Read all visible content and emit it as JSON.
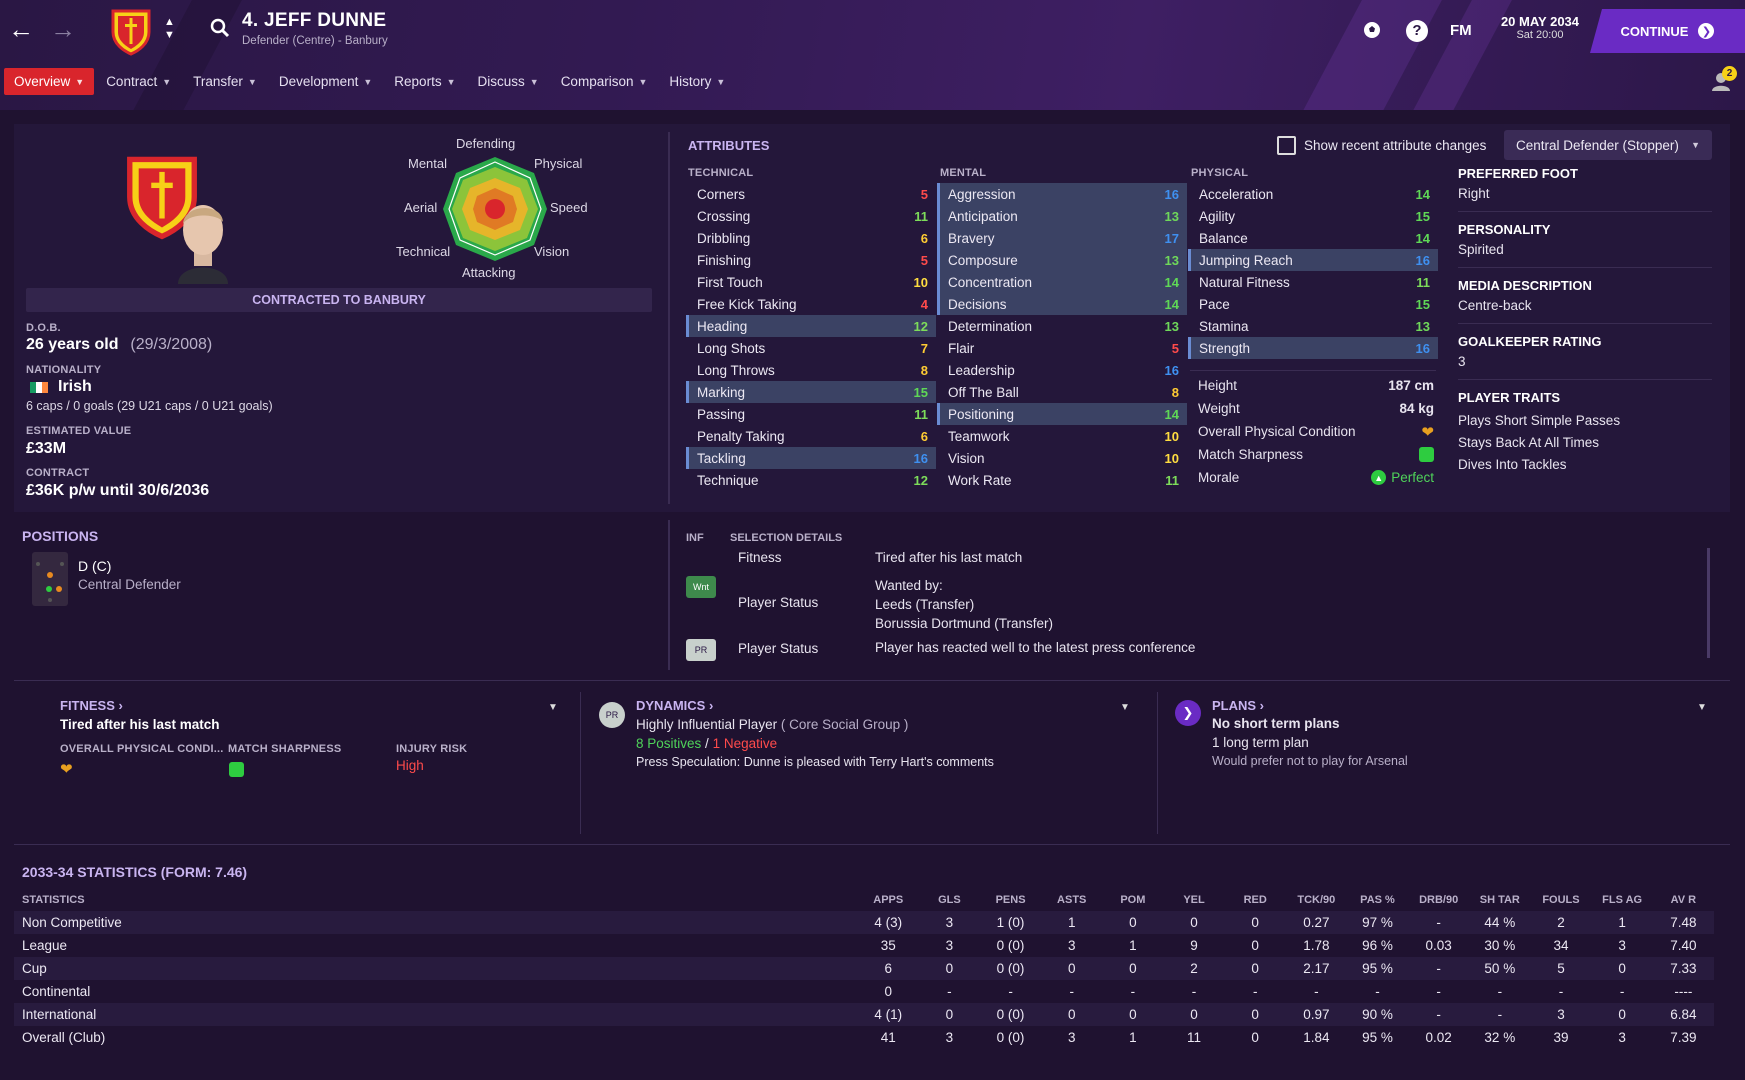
{
  "header": {
    "title": "4. JEFF DUNNE",
    "subtitle": "Defender (Centre) - Banbury",
    "date": "20 MAY 2034",
    "time": "Sat 20:00",
    "fm_label": "FM",
    "continue_label": "CONTINUE",
    "help": "?",
    "notification_count": "2"
  },
  "tabs": [
    {
      "label": "Overview"
    },
    {
      "label": "Contract"
    },
    {
      "label": "Transfer"
    },
    {
      "label": "Development"
    },
    {
      "label": "Reports"
    },
    {
      "label": "Discuss"
    },
    {
      "label": "Comparison"
    },
    {
      "label": "History"
    }
  ],
  "radar": {
    "top": "Defending",
    "top_left": "Mental",
    "top_right": "Physical",
    "left": "Aerial",
    "right": "Speed",
    "bottom_left": "Technical",
    "bottom_right": "Vision",
    "bottom": "Attacking"
  },
  "profile": {
    "contract_banner": "CONTRACTED TO BANBURY",
    "dob_label": "D.O.B.",
    "age": "26 years old",
    "dob": "(29/3/2008)",
    "nationality_label": "NATIONALITY",
    "nationality": "Irish",
    "caps": "6 caps / 0 goals (29 U21 caps / 0 U21 goals)",
    "value_label": "ESTIMATED VALUE",
    "value": "£33M",
    "contract_label": "CONTRACT",
    "contract": "£36K p/w until 30/6/2036"
  },
  "attributes": {
    "title": "ATTRIBUTES",
    "show_changes": "Show recent attribute changes",
    "role": "Central Defender (Stopper)",
    "technical_label": "TECHNICAL",
    "mental_label": "MENTAL",
    "physical_label": "PHYSICAL",
    "technical": [
      {
        "name": "Corners",
        "value": "5",
        "hl": false
      },
      {
        "name": "Crossing",
        "value": "11",
        "hl": false
      },
      {
        "name": "Dribbling",
        "value": "6",
        "hl": false
      },
      {
        "name": "Finishing",
        "value": "5",
        "hl": false
      },
      {
        "name": "First Touch",
        "value": "10",
        "hl": false
      },
      {
        "name": "Free Kick Taking",
        "value": "4",
        "hl": false
      },
      {
        "name": "Heading",
        "value": "12",
        "hl": true
      },
      {
        "name": "Long Shots",
        "value": "7",
        "hl": false
      },
      {
        "name": "Long Throws",
        "value": "8",
        "hl": false
      },
      {
        "name": "Marking",
        "value": "15",
        "hl": true
      },
      {
        "name": "Passing",
        "value": "11",
        "hl": false
      },
      {
        "name": "Penalty Taking",
        "value": "6",
        "hl": false
      },
      {
        "name": "Tackling",
        "value": "16",
        "hl": true
      },
      {
        "name": "Technique",
        "value": "12",
        "hl": false
      }
    ],
    "mental": [
      {
        "name": "Aggression",
        "value": "16",
        "hl": true
      },
      {
        "name": "Anticipation",
        "value": "13",
        "hl": true
      },
      {
        "name": "Bravery",
        "value": "17",
        "hl": true
      },
      {
        "name": "Composure",
        "value": "13",
        "hl": true
      },
      {
        "name": "Concentration",
        "value": "14",
        "hl": true
      },
      {
        "name": "Decisions",
        "value": "14",
        "hl": true
      },
      {
        "name": "Determination",
        "value": "13",
        "hl": false
      },
      {
        "name": "Flair",
        "value": "5",
        "hl": false
      },
      {
        "name": "Leadership",
        "value": "16",
        "hl": false
      },
      {
        "name": "Off The Ball",
        "value": "8",
        "hl": false
      },
      {
        "name": "Positioning",
        "value": "14",
        "hl": true
      },
      {
        "name": "Teamwork",
        "value": "10",
        "hl": false
      },
      {
        "name": "Vision",
        "value": "10",
        "hl": false
      },
      {
        "name": "Work Rate",
        "value": "11",
        "hl": false
      }
    ],
    "physical": [
      {
        "name": "Acceleration",
        "value": "14",
        "hl": false
      },
      {
        "name": "Agility",
        "value": "15",
        "hl": false
      },
      {
        "name": "Balance",
        "value": "14",
        "hl": false
      },
      {
        "name": "Jumping Reach",
        "value": "16",
        "hl": true
      },
      {
        "name": "Natural Fitness",
        "value": "11",
        "hl": false
      },
      {
        "name": "Pace",
        "value": "15",
        "hl": false
      },
      {
        "name": "Stamina",
        "value": "13",
        "hl": false
      },
      {
        "name": "Strength",
        "value": "16",
        "hl": true
      }
    ],
    "height_label": "Height",
    "height": "187 cm",
    "weight_label": "Weight",
    "weight": "84 kg",
    "condition_label": "Overall Physical Condition",
    "sharpness_label": "Match Sharpness",
    "morale_label": "Morale",
    "morale": "Perfect"
  },
  "info": {
    "foot_label": "PREFERRED FOOT",
    "foot": "Right",
    "personality_label": "PERSONALITY",
    "personality": "Spirited",
    "media_label": "MEDIA DESCRIPTION",
    "media": "Centre-back",
    "gk_label": "GOALKEEPER RATING",
    "gk": "3",
    "traits_label": "PLAYER TRAITS",
    "traits": [
      "Plays Short Simple Passes",
      "Stays Back At All Times",
      "Dives Into Tackles"
    ]
  },
  "positions": {
    "title": "POSITIONS",
    "code": "D (C)",
    "name": "Central Defender"
  },
  "selection": {
    "inf_label": "INF",
    "details_label": "SELECTION DETAILS",
    "rows": [
      {
        "badge": "",
        "label": "Fitness",
        "text": "Tired after his last match"
      },
      {
        "badge": "Wnt",
        "label": "Player Status",
        "text": "Wanted by:\nLeeds (Transfer)\nBorussia Dortmund (Transfer)"
      },
      {
        "badge": "PR",
        "label": "Player Status",
        "text": "Player has reacted well to the latest press conference"
      }
    ]
  },
  "fitness": {
    "title": "FITNESS",
    "status": "Tired after his last match",
    "condition_label": "OVERALL PHYSICAL CONDI...",
    "sharpness_label": "MATCH SHARPNESS",
    "injury_label": "INJURY RISK",
    "injury": "High"
  },
  "dynamics": {
    "title": "DYNAMICS",
    "badge": "PR",
    "influence": "Highly Influential Player",
    "group": "( Core Social Group )",
    "positives": "8 Positives",
    "sep": "/",
    "negatives": "1 Negative",
    "note": "Press Speculation: Dunne is pleased with Terry Hart's comments"
  },
  "plans": {
    "title": "PLANS",
    "short": "No short term plans",
    "long": "1 long term plan",
    "note": "Would prefer not to play for Arsenal"
  },
  "stats": {
    "title": "2033-34 STATISTICS (FORM: 7.46)",
    "headers": [
      "STATISTICS",
      "APPS",
      "GLS",
      "PENS",
      "ASTS",
      "POM",
      "YEL",
      "RED",
      "TCK/90",
      "PAS %",
      "DRB/90",
      "SH TAR",
      "FOULS",
      "FLS AG",
      "AV R"
    ],
    "rows": [
      [
        "Non Competitive",
        "4 (3)",
        "3",
        "1 (0)",
        "1",
        "0",
        "0",
        "0",
        "0.27",
        "97 %",
        "-",
        "44 %",
        "2",
        "1",
        "7.48"
      ],
      [
        "League",
        "35",
        "3",
        "0 (0)",
        "3",
        "1",
        "9",
        "0",
        "1.78",
        "96 %",
        "0.03",
        "30 %",
        "34",
        "3",
        "7.40"
      ],
      [
        "Cup",
        "6",
        "0",
        "0 (0)",
        "0",
        "0",
        "2",
        "0",
        "2.17",
        "95 %",
        "-",
        "50 %",
        "5",
        "0",
        "7.33"
      ],
      [
        "Continental",
        "0",
        "-",
        "-",
        "-",
        "-",
        "-",
        "-",
        "-",
        "-",
        "-",
        "-",
        "-",
        "-",
        "----"
      ],
      [
        "International",
        "4 (1)",
        "0",
        "0 (0)",
        "0",
        "0",
        "0",
        "0",
        "0.97",
        "90 %",
        "-",
        "-",
        "3",
        "0",
        "6.84"
      ],
      [
        "Overall (Club)",
        "41",
        "3",
        "0 (0)",
        "3",
        "1",
        "11",
        "0",
        "1.84",
        "95 %",
        "0.02",
        "32 %",
        "39",
        "3",
        "7.39"
      ]
    ]
  }
}
